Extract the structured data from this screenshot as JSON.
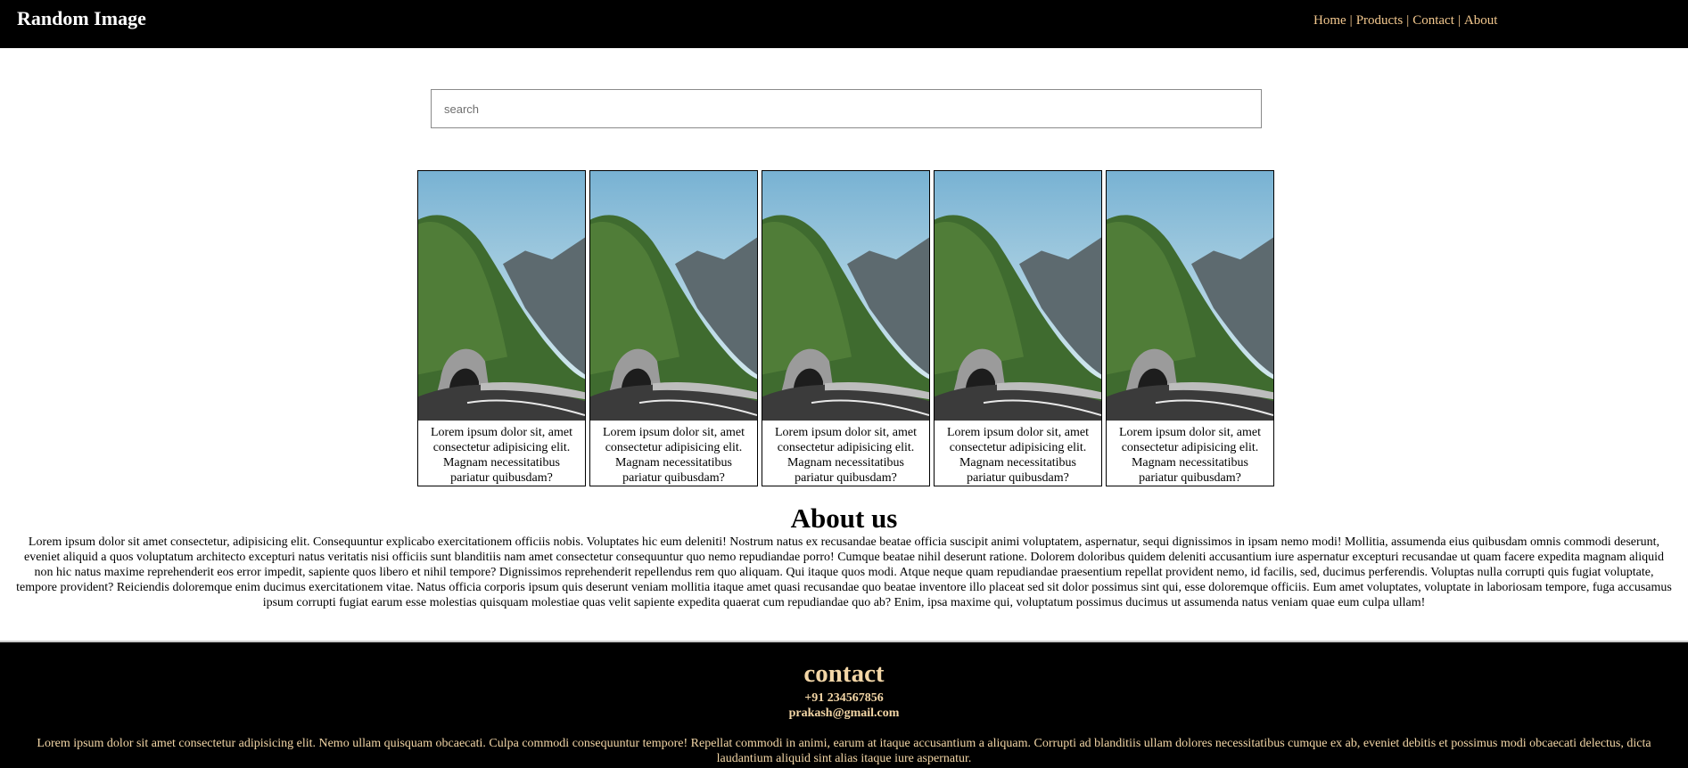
{
  "header": {
    "brand": "Random Image",
    "nav": [
      {
        "label": "Home"
      },
      {
        "label": "Products"
      },
      {
        "label": "Contact"
      },
      {
        "label": "About"
      }
    ],
    "separator": "|"
  },
  "search": {
    "placeholder": "search",
    "value": ""
  },
  "cards": [
    {
      "image": "mountain-road-tunnel-image",
      "text": "Lorem ipsum dolor sit, amet consectetur adipisicing elit. Magnam necessitatibus pariatur quibusdam?"
    },
    {
      "image": "mountain-road-tunnel-image",
      "text": "Lorem ipsum dolor sit, amet consectetur adipisicing elit. Magnam necessitatibus pariatur quibusdam?"
    },
    {
      "image": "mountain-road-tunnel-image",
      "text": "Lorem ipsum dolor sit, amet consectetur adipisicing elit. Magnam necessitatibus pariatur quibusdam?"
    },
    {
      "image": "mountain-road-tunnel-image",
      "text": "Lorem ipsum dolor sit, amet consectetur adipisicing elit. Magnam necessitatibus pariatur quibusdam?"
    },
    {
      "image": "mountain-road-tunnel-image",
      "text": "Lorem ipsum dolor sit, amet consectetur adipisicing elit. Magnam necessitatibus pariatur quibusdam?"
    }
  ],
  "about": {
    "title": "About us",
    "body": "Lorem ipsum dolor sit amet consectetur, adipisicing elit. Consequuntur explicabo exercitationem officiis nobis. Voluptates hic eum deleniti! Nostrum natus ex recusandae beatae officia suscipit animi voluptatem, aspernatur, sequi dignissimos in ipsam nemo modi! Mollitia, assumenda eius quibusdam omnis commodi deserunt, eveniet aliquid a quos voluptatum architecto excepturi natus veritatis nisi officiis sunt blanditiis nam amet consectetur consequuntur quo nemo repudiandae porro! Cumque beatae nihil deserunt ratione. Dolorem doloribus quidem deleniti accusantium iure aspernatur excepturi recusandae ut quam facere expedita magnam aliquid non hic natus maxime reprehenderit eos error impedit, sapiente quos libero et nihil tempore? Dignissimos reprehenderit repellendus rem quo aliquam. Qui itaque quos modi. Atque neque quam repudiandae praesentium repellat provident nemo, id facilis, sed, ducimus perferendis. Voluptas nulla corrupti quis fugiat voluptate, tempore provident? Reiciendis doloremque enim ducimus exercitationem vitae. Natus officia corporis ipsum quis deserunt veniam mollitia itaque amet quasi recusandae quo beatae inventore illo placeat sed sit dolor possimus sint qui, esse doloremque officiis. Eum amet voluptates, voluptate in laboriosam tempore, fuga accusamus ipsum corrupti fugiat earum esse molestias quisquam molestiae quas velit sapiente expedita quaerat cum repudiandae quo ab? Enim, ipsa maxime qui, voluptatum possimus ducimus ut assumenda natus veniam quae eum culpa ullam!"
  },
  "footer": {
    "title": "contact",
    "phone": "+91 234567856",
    "email": "prakash@gmail.com",
    "body": "Lorem ipsum dolor sit amet consectetur adipisicing elit. Nemo ullam quisquam obcaecati. Culpa commodi consequuntur tempore! Repellat commodi in animi, earum at itaque accusantium a aliquam. Corrupti ad blanditiis ullam dolores necessitatibus cumque ex ab, eveniet debitis et possimus modi obcaecati delectus, dicta laudantium aliquid sint alias itaque iure aspernatur."
  },
  "colors": {
    "header_bg": "#000000",
    "nav_link": "#f3c88e",
    "footer_text": "#f3d6a6",
    "page_bg": "#ffffff"
  }
}
